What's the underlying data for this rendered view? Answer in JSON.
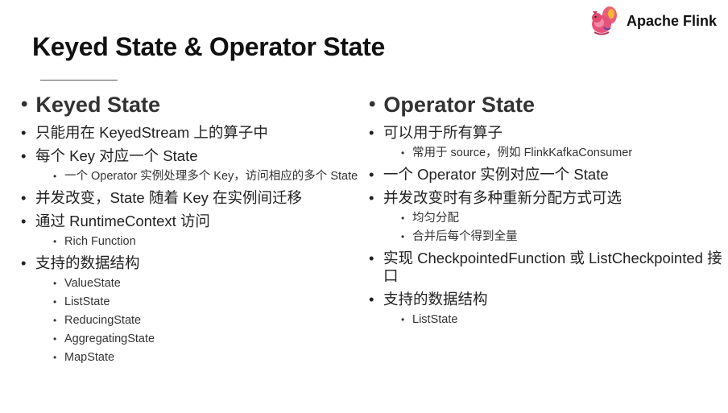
{
  "title": "Keyed State & Operator State",
  "brand": {
    "name": "Apache Flink",
    "logo_icon": "flink-squirrel-logo"
  },
  "left": {
    "heading": "Keyed State",
    "items": [
      {
        "text": "只能用在 KeyedStream 上的算子中",
        "sub": []
      },
      {
        "text": "每个 Key 对应一个 State",
        "sub": [
          "一个 Operator 实例处理多个 Key，访问相应的多个 State"
        ]
      },
      {
        "text": "并发改变，State 随着 Key 在实例间迁移",
        "sub": []
      },
      {
        "text": "通过 RuntimeContext 访问",
        "sub": [
          "Rich Function"
        ]
      },
      {
        "text": "支持的数据结构",
        "sub": [
          "ValueState",
          "ListState",
          "ReducingState",
          "AggregatingState",
          "MapState"
        ]
      }
    ]
  },
  "right": {
    "heading": "Operator State",
    "items": [
      {
        "text": "可以用于所有算子",
        "sub": [
          "常用于 source，例如 FlinkKafkaConsumer"
        ]
      },
      {
        "text": "一个 Operator 实例对应一个 State",
        "sub": []
      },
      {
        "text": "并发改变时有多种重新分配方式可选",
        "sub": [
          "均匀分配",
          "合并后每个得到全量"
        ]
      },
      {
        "text": "实现 CheckpointedFunction 或 ListCheckpointed 接口",
        "sub": []
      },
      {
        "text": "支持的数据结构",
        "sub": [
          "ListState"
        ]
      }
    ]
  },
  "colors": {
    "title": "#111111",
    "text": "#222222",
    "heading": "#333333"
  }
}
